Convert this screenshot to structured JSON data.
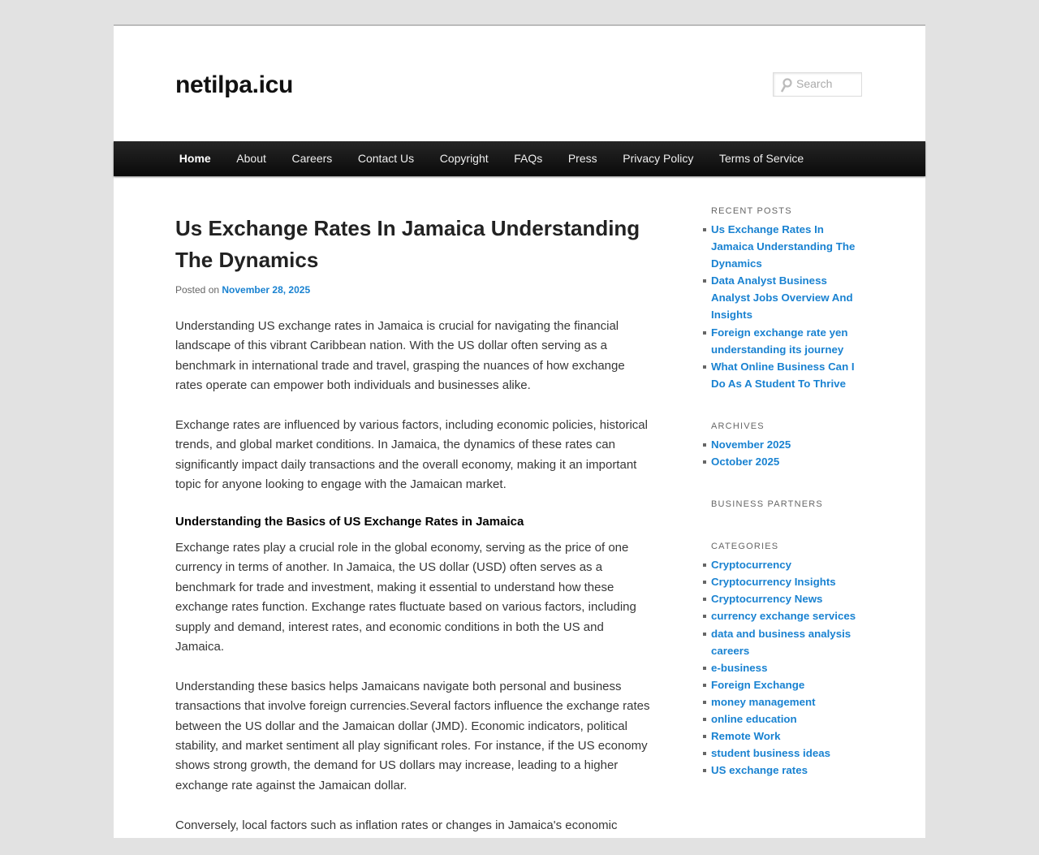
{
  "site": {
    "title": "netilpa.icu",
    "search_placeholder": "Search"
  },
  "nav": [
    "Home",
    "About",
    "Careers",
    "Contact Us",
    "Copyright",
    "FAQs",
    "Press",
    "Privacy Policy",
    "Terms of Service"
  ],
  "post": {
    "title": "Us Exchange Rates In Jamaica Understanding The Dynamics",
    "posted_on": "Posted on",
    "date": "November 28, 2025",
    "p1": "Understanding US exchange rates in Jamaica is crucial for navigating the financial landscape of this vibrant Caribbean nation. With the US dollar often serving as a benchmark in international trade and travel, grasping the nuances of how exchange rates operate can empower both individuals and businesses alike.",
    "p2": "Exchange rates are influenced by various factors, including economic policies, historical trends, and global market conditions. In Jamaica, the dynamics of these rates can significantly impact daily transactions and the overall economy, making it an important topic for anyone looking to engage with the Jamaican market.",
    "h3": "Understanding the Basics of US Exchange Rates in Jamaica",
    "p3": "Exchange rates play a crucial role in the global economy, serving as the price of one currency in terms of another. In Jamaica, the US dollar (USD) often serves as a benchmark for trade and investment, making it essential to understand how these exchange rates function. Exchange rates fluctuate based on various factors, including supply and demand, interest rates, and economic conditions in both the US and Jamaica.",
    "p4": "Understanding these basics helps Jamaicans navigate both personal and business transactions that involve foreign currencies.Several factors influence the exchange rates between the US dollar and the Jamaican dollar (JMD). Economic indicators, political stability, and market sentiment all play significant roles. For instance, if the US economy shows strong growth, the demand for US dollars may increase, leading to a higher exchange rate against the Jamaican dollar.",
    "p5": "Conversely, local factors such as inflation rates or changes in Jamaica's economic"
  },
  "sidebar": {
    "recent_title": "Recent Posts",
    "recent": [
      "Us Exchange Rates In Jamaica Understanding The Dynamics",
      "Data Analyst Business Analyst Jobs Overview And Insights",
      "Foreign exchange rate yen understanding its journey",
      "What Online Business Can I Do As A Student To Thrive"
    ],
    "archives_title": "Archives",
    "archives": [
      "November 2025",
      "October 2025"
    ],
    "partners_title": "Business Partners",
    "categories_title": "Categories",
    "categories": [
      "Cryptocurrency",
      "Cryptocurrency Insights",
      "Cryptocurrency News",
      "currency exchange services",
      "data and business analysis careers",
      "e-business",
      "Foreign Exchange",
      "money management",
      "online education",
      "Remote Work",
      "student business ideas",
      "US exchange rates"
    ]
  }
}
